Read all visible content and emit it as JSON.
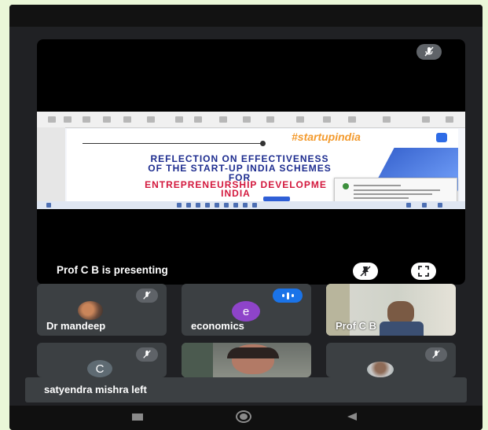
{
  "presentation": {
    "presenter_label": "Prof C B is presenting",
    "slide": {
      "hashtag": "#startupindia",
      "title_line1": "REFLECTION ON EFFECTIVENESS",
      "title_line2": "OF THE START-UP INDIA SCHEMES",
      "title_line3": "FOR",
      "title_line4": "ENTREPRENEURSHIP DEVELOPME",
      "title_line5": "INDIA"
    }
  },
  "participants": [
    {
      "name": "Dr mandeep",
      "muted": true
    },
    {
      "name": "economics",
      "initial": "e",
      "avatar_color": "#8e44c9",
      "speaking": true
    },
    {
      "name": "Prof C B",
      "video": true
    },
    {
      "name": "",
      "initial": "C",
      "avatar_color": "#5f6b73",
      "muted": true
    },
    {
      "name": "",
      "video": true
    },
    {
      "name": "",
      "muted": true
    }
  ],
  "toast": {
    "message": "satyendra mishra left"
  },
  "colors": {
    "screen_bg": "#202124",
    "tile_bg": "#3c4043",
    "accent_blue": "#1a73e8"
  }
}
